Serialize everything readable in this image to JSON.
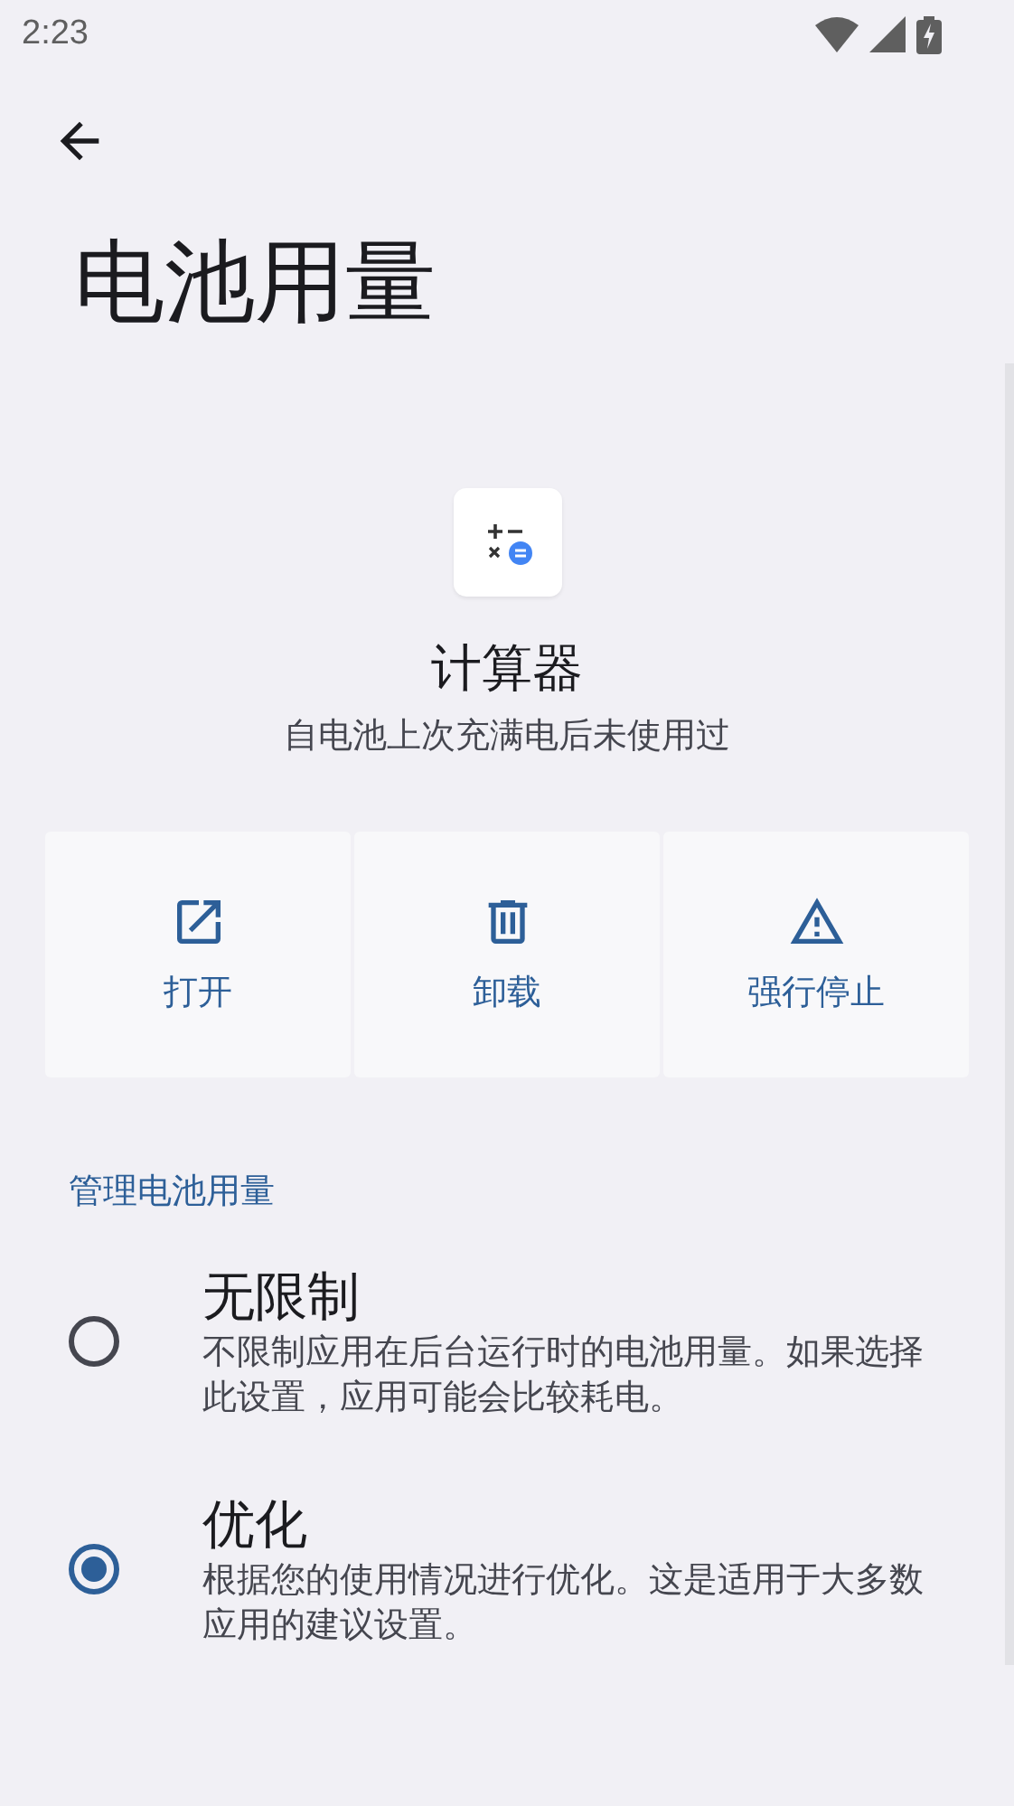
{
  "status_bar": {
    "time": "2:23"
  },
  "page": {
    "title": "电池用量"
  },
  "app": {
    "name": "计算器",
    "subtitle": "自电池上次充满电后未使用过"
  },
  "actions": [
    {
      "kind": "open",
      "label": "打开"
    },
    {
      "kind": "uninstall",
      "label": "卸载"
    },
    {
      "kind": "force_stop",
      "label": "强行停止"
    }
  ],
  "section": {
    "title": "管理电池用量"
  },
  "options": [
    {
      "title": "无限制",
      "description": "不限制应用在后台运行时的电池用量。如果选择此设置，应用可能会比较耗电。",
      "selected": false
    },
    {
      "title": "优化",
      "description": "根据您的使用情况进行优化。这是适用于大多数应用的建议设置。",
      "selected": true
    }
  ]
}
